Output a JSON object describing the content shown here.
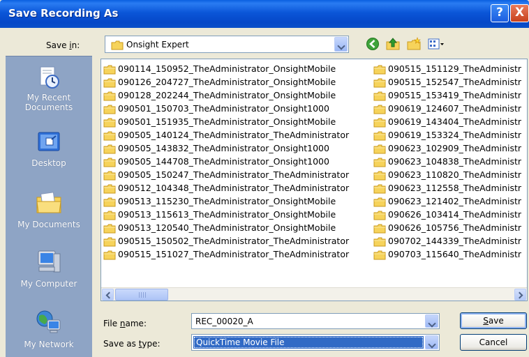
{
  "window": {
    "title": "Save Recording As"
  },
  "titlebar_buttons": {
    "help": "?",
    "close": "X"
  },
  "save_in": {
    "label_pre": "Save ",
    "label_key": "i",
    "label_post": "n:",
    "value": "Onsight Expert"
  },
  "toolbar": {
    "icons": [
      "back-icon",
      "up-folder-icon",
      "new-folder-icon",
      "views-menu-icon"
    ]
  },
  "places": [
    {
      "label": "My Recent Documents",
      "icon": "recent-documents-icon"
    },
    {
      "label": "Desktop",
      "icon": "desktop-icon"
    },
    {
      "label": "My Documents",
      "icon": "my-documents-icon"
    },
    {
      "label": "My Computer",
      "icon": "my-computer-icon"
    },
    {
      "label": "My Network",
      "icon": "my-network-icon"
    }
  ],
  "files_col1": [
    "090114_150952_TheAdministrator_OnsightMobile",
    "090126_204727_TheAdministrator_OnsightMobile",
    "090128_202244_TheAdministrator_OnsightMobile",
    "090501_150703_TheAdministrator_Onsight1000",
    "090501_151935_TheAdministrator_OnsightMobile",
    "090505_140124_TheAdministrator_TheAdministrator",
    "090505_143832_TheAdministrator_Onsight1000",
    "090505_144708_TheAdministrator_Onsight1000",
    "090505_150247_TheAdministrator_TheAdministrator",
    "090512_104348_TheAdministrator_TheAdministrator",
    "090513_115230_TheAdministrator_OnsightMobile",
    "090513_115613_TheAdministrator_OnsightMobile",
    "090513_120540_TheAdministrator_OnsightMobile",
    "090515_150502_TheAdministrator_TheAdministrator",
    "090515_151027_TheAdministrator_TheAdministrator"
  ],
  "files_col2": [
    "090515_151129_TheAdministr",
    "090515_152547_TheAdministr",
    "090515_153419_TheAdministr",
    "090619_124607_TheAdministr",
    "090619_143404_TheAdministr",
    "090619_153324_TheAdministr",
    "090623_102909_TheAdministr",
    "090623_104838_TheAdministr",
    "090623_110820_TheAdministr",
    "090623_112558_TheAdministr",
    "090623_121402_TheAdministr",
    "090626_103414_TheAdministr",
    "090626_105756_TheAdministr",
    "090702_144339_TheAdministr",
    "090703_115640_TheAdministr"
  ],
  "file_name": {
    "label_pre": "File ",
    "label_key": "n",
    "label_post": "ame:",
    "value": "REC_00020_A"
  },
  "save_type": {
    "label_pre": "Save as ",
    "label_key": "t",
    "label_post": "ype:",
    "value": "QuickTime Movie File"
  },
  "buttons": {
    "save_key": "S",
    "save_rest": "ave",
    "cancel": "Cancel"
  },
  "colors": {
    "titlebar": "#0A5FE0",
    "places_bar": "#8EA4C5",
    "selection": "#316AC5",
    "dialog_bg": "#ECE9D8"
  }
}
